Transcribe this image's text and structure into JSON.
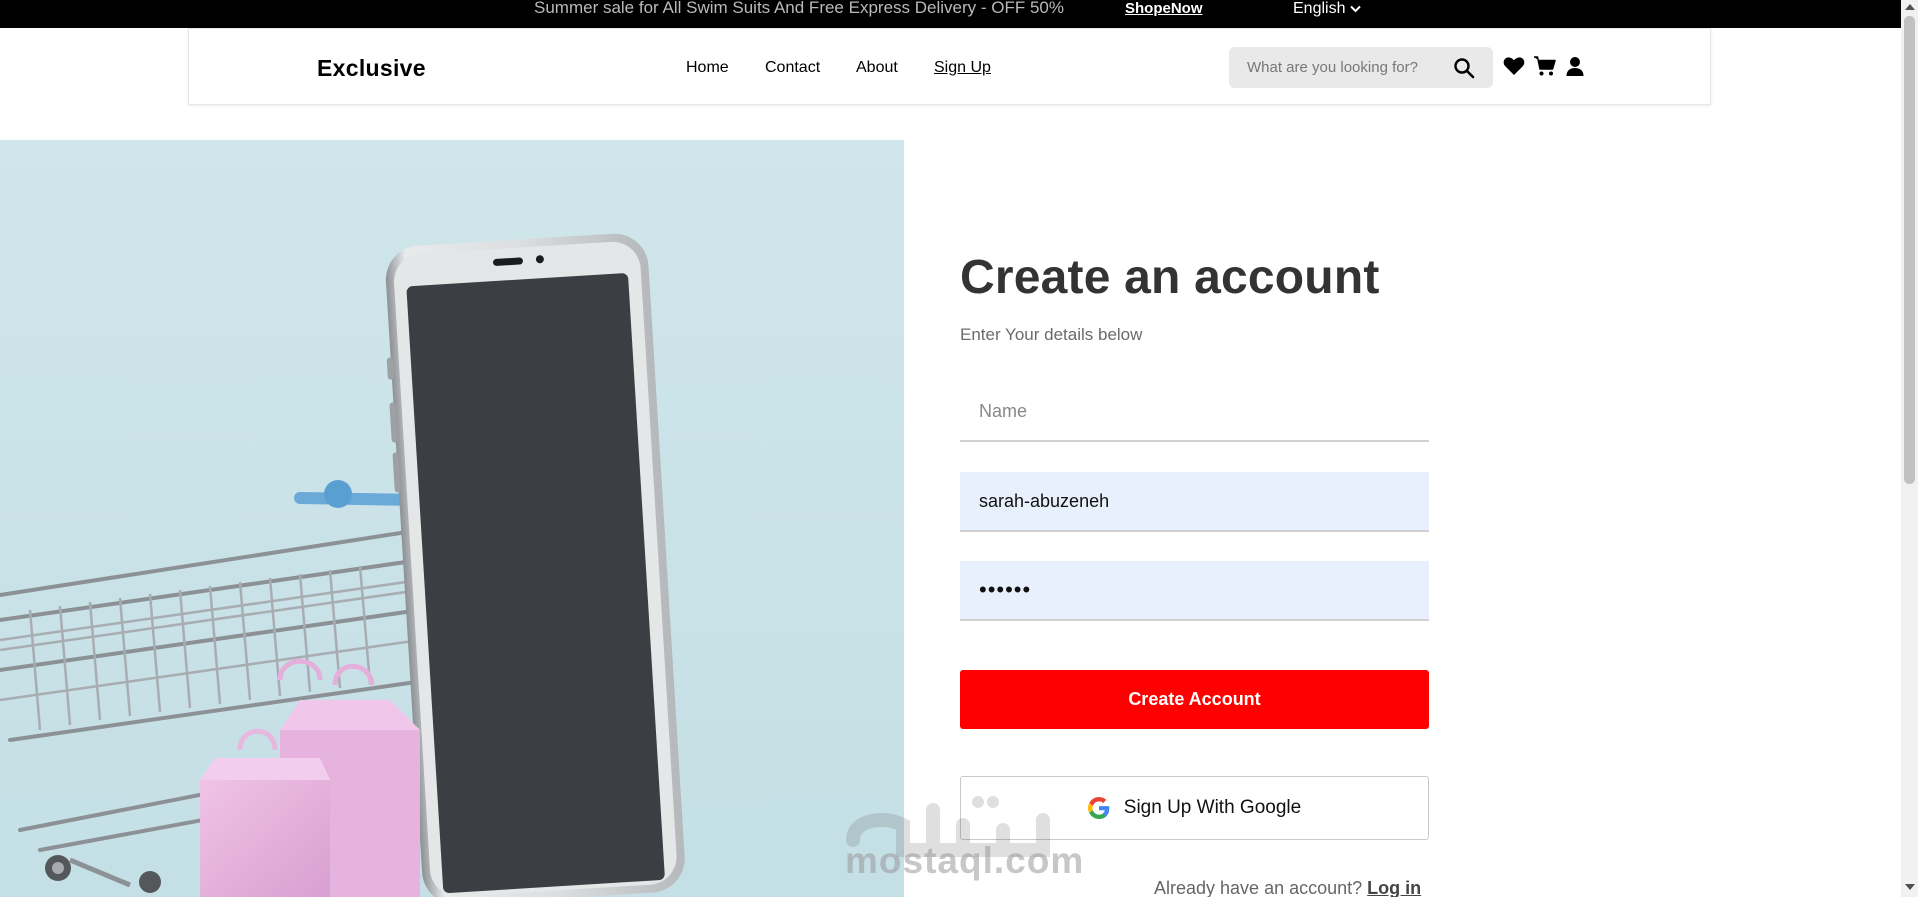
{
  "topbar": {
    "promo_text": "Summer sale for All Swim Suits And Free Express Delivery - OFF 50%",
    "promo_link": "ShopeNow",
    "language": "English"
  },
  "header": {
    "logo": "Exclusive",
    "nav": [
      "Home",
      "Contact",
      "About",
      "Sign Up"
    ],
    "active_nav": "Sign Up",
    "search_placeholder": "What are you looking for?",
    "icons": [
      "search-icon",
      "heart-icon",
      "cart-icon",
      "user-icon"
    ]
  },
  "form": {
    "title": "Create an account",
    "subtitle": "Enter Your details below",
    "name_placeholder": "Name",
    "email_value": "sarah-abuzeneh",
    "password_value": "••••••",
    "create_button": "Create Account",
    "google_button": "Sign Up With Google",
    "login_prompt": "Already have an account?",
    "login_link": "Log in"
  },
  "watermark": {
    "text": "mostaql.com"
  },
  "colors": {
    "accent": "#ff0000",
    "topbar_bg": "#000000",
    "hero_bg": "#cde5ea",
    "autofill_bg": "#e8f0fe"
  }
}
